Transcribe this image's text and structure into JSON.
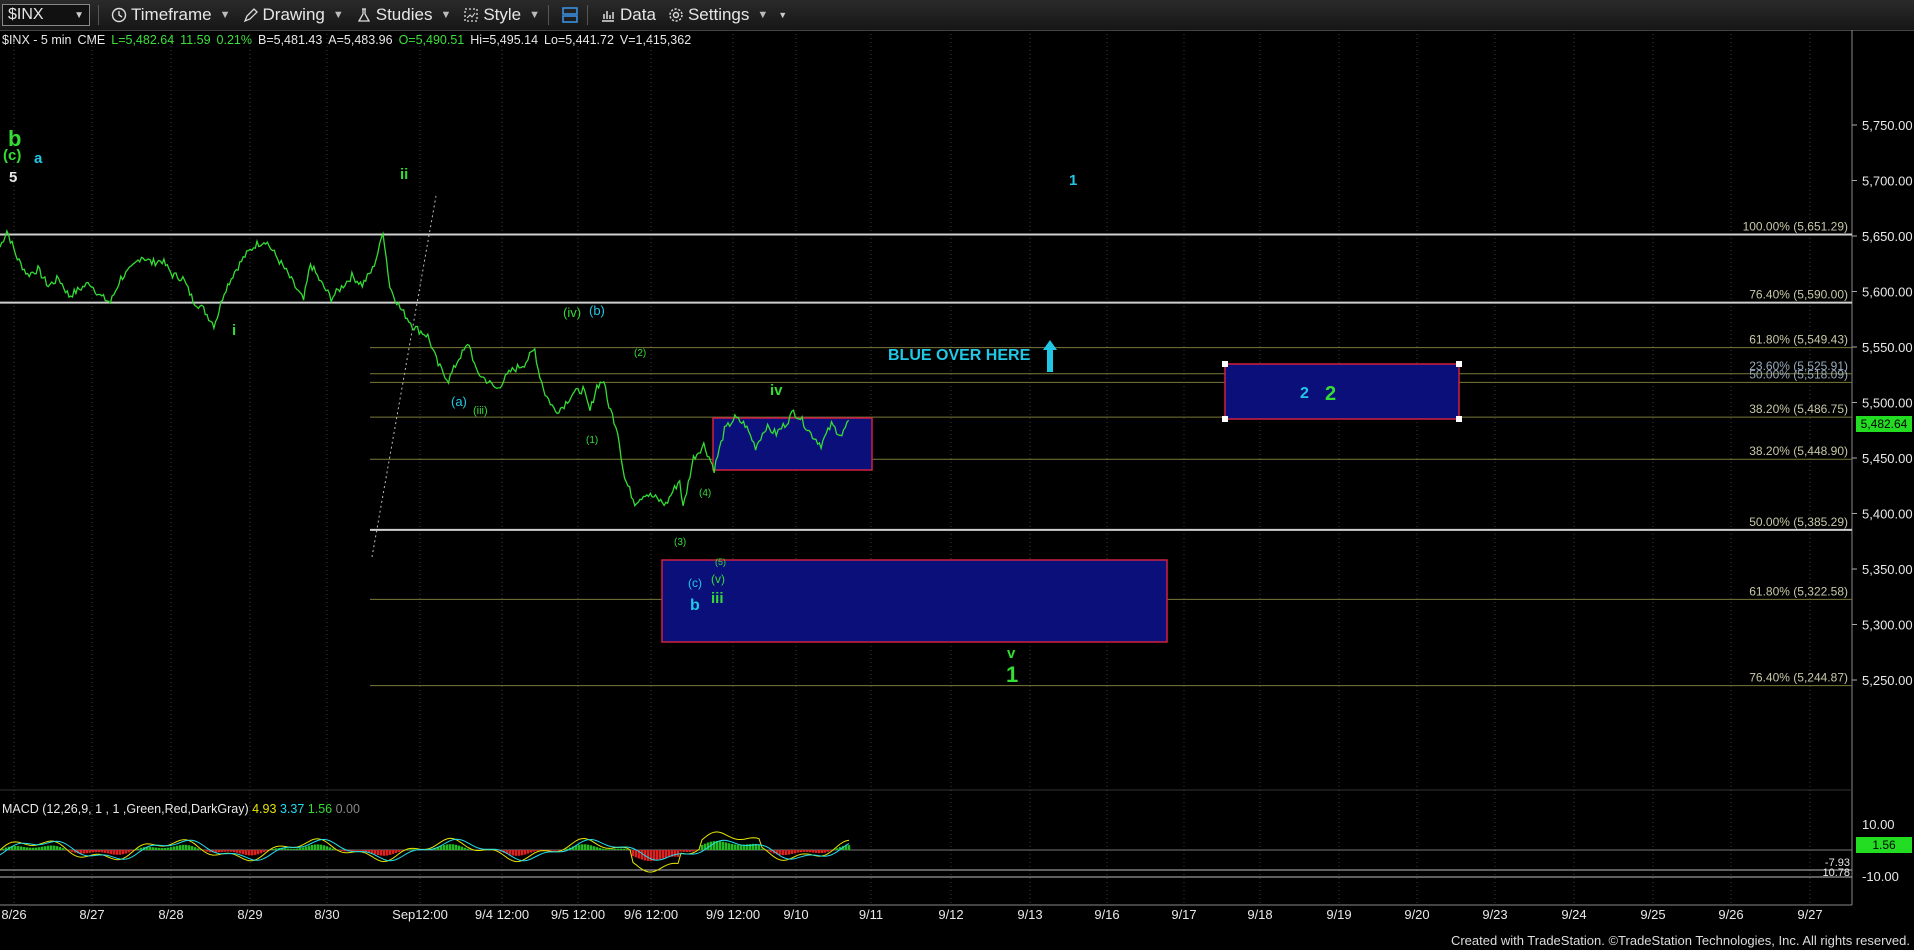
{
  "toolbar": {
    "symbol": "$INX",
    "timeframe": "Timeframe",
    "drawing": "Drawing",
    "studies": "Studies",
    "style": "Style",
    "data": "Data",
    "settings": "Settings"
  },
  "infobar": {
    "symbol": "$INX - 5 min",
    "exchange": "CME",
    "last": "L=5,482.64",
    "change": "11.59",
    "change_pct": "0.21%",
    "bid": "B=5,481.43",
    "ask": "A=5,483.96",
    "open": "O=5,490.51",
    "high": "Hi=5,495.14",
    "low": "Lo=5,441.72",
    "volume": "V=1,415,362"
  },
  "colors": {
    "background": "#000000",
    "price_line": "#33dd33",
    "fib_line": "#7a7a2a",
    "white_line": "#cfcfcf",
    "box_fill": "#0b0f7a",
    "box_border": "#d02040",
    "label_green": "#33dd33",
    "label_blue": "#3ab6e8",
    "label_cyan": "#21c8e6",
    "price_tag": "#22dd22"
  },
  "chart_data": {
    "type": "line",
    "price_axis": {
      "ticks": [
        "5,750.00",
        "5,700.00",
        "5,650.00",
        "5,600.00",
        "5,550.00",
        "5,500.00",
        "5,450.00",
        "5,400.00",
        "5,350.00",
        "5,300.00",
        "5,250.00"
      ],
      "ylim": [
        5215,
        5765
      ],
      "current_price": "5,482.64"
    },
    "macd_axis": {
      "ticks": [
        "10.00",
        "-10.00"
      ],
      "current": "1.56",
      "level_a": "-7.93",
      "level_b": "10.78"
    },
    "x_ticks": [
      "8/26",
      "8/27",
      "8/28",
      "8/29",
      "8/30",
      "Sep12:00",
      "9/4 12:00",
      "9/5 12:00",
      "9/6 12:00",
      "9/9 12:00",
      "9/10",
      "9/11",
      "9/12",
      "9/13",
      "9/16",
      "9/17",
      "9/18",
      "9/19",
      "9/20",
      "9/23",
      "9/24",
      "9/25",
      "9/26",
      "9/27"
    ],
    "fib_levels": [
      {
        "label": "100.00% (5,651.29)",
        "value": 5651.3
      },
      {
        "label": "76.40% (5,590.00)",
        "value": 5590.0
      },
      {
        "label": "61.80% (5,549.43)",
        "value": 5549.4
      },
      {
        "label": "23.60% (5,525.91)",
        "value": 5525.9
      },
      {
        "label": "50.00% (5,518.09)",
        "value": 5518.1
      },
      {
        "label": "38.20% (5,486.75)",
        "value": 5486.8
      },
      {
        "label": "38.20% (5,448.90)",
        "value": 5448.9
      },
      {
        "label": "50.00% (5,385.29)",
        "value": 5385.3
      },
      {
        "label": "61.80% (5,322.58)",
        "value": 5322.6
      },
      {
        "label": "76.40% (5,244.87)",
        "value": 5244.9
      }
    ],
    "price_series": [
      [
        0,
        5640
      ],
      [
        2,
        5655
      ],
      [
        5,
        5630
      ],
      [
        8,
        5615
      ],
      [
        11,
        5620
      ],
      [
        14,
        5605
      ],
      [
        17,
        5612
      ],
      [
        20,
        5596
      ],
      [
        23,
        5602
      ],
      [
        26,
        5608
      ],
      [
        29,
        5596
      ],
      [
        32,
        5590
      ],
      [
        35,
        5612
      ],
      [
        38,
        5620
      ],
      [
        41,
        5632
      ],
      [
        44,
        5626
      ],
      [
        47,
        5628
      ],
      [
        50,
        5615
      ],
      [
        53,
        5612
      ],
      [
        56,
        5592
      ],
      [
        59,
        5584
      ],
      [
        62,
        5570
      ],
      [
        63,
        5578
      ],
      [
        65,
        5600
      ],
      [
        68,
        5618
      ],
      [
        71,
        5632
      ],
      [
        74,
        5642
      ],
      [
        77,
        5646
      ],
      [
        80,
        5632
      ],
      [
        83,
        5618
      ],
      [
        86,
        5602
      ],
      [
        88,
        5592
      ],
      [
        90,
        5625
      ],
      [
        93,
        5608
      ],
      [
        96,
        5594
      ],
      [
        99,
        5604
      ],
      [
        102,
        5614
      ],
      [
        105,
        5606
      ],
      [
        108,
        5620
      ],
      [
        110,
        5640
      ],
      [
        111,
        5655
      ],
      [
        113,
        5604
      ],
      [
        116,
        5585
      ],
      [
        120,
        5568
      ],
      [
        124,
        5560
      ],
      [
        127,
        5534
      ],
      [
        130,
        5520
      ],
      [
        133,
        5540
      ],
      [
        136,
        5553
      ],
      [
        138,
        5528
      ],
      [
        141,
        5520
      ],
      [
        144,
        5512
      ],
      [
        148,
        5528
      ],
      [
        152,
        5535
      ],
      [
        155,
        5548
      ],
      [
        156,
        5530
      ],
      [
        158,
        5508
      ],
      [
        161,
        5492
      ],
      [
        163,
        5496
      ],
      [
        166,
        5508
      ],
      [
        169,
        5512
      ],
      [
        171,
        5492
      ],
      [
        173,
        5515
      ],
      [
        175,
        5520
      ],
      [
        176,
        5502
      ],
      [
        179,
        5475
      ],
      [
        181,
        5432
      ],
      [
        184,
        5410
      ],
      [
        187,
        5418
      ],
      [
        190,
        5414
      ],
      [
        193,
        5408
      ],
      [
        195,
        5420
      ],
      [
        197,
        5430
      ],
      [
        198,
        5405
      ],
      [
        201,
        5450
      ],
      [
        204,
        5462
      ],
      [
        207,
        5440
      ],
      [
        210,
        5475
      ],
      [
        213,
        5486
      ],
      [
        216,
        5480
      ],
      [
        219,
        5460
      ],
      [
        222,
        5478
      ],
      [
        225,
        5472
      ],
      [
        228,
        5482
      ],
      [
        230,
        5492
      ],
      [
        232,
        5486
      ],
      [
        235,
        5472
      ],
      [
        238,
        5462
      ],
      [
        241,
        5480
      ],
      [
        244,
        5470
      ],
      [
        246,
        5484
      ]
    ],
    "x_index_ticks": [
      "8/26",
      "8/27",
      "8/28",
      "8/29",
      "8/30",
      "Sep12:00",
      "9/4 12:00",
      "9/5 12:00",
      "9/6 12:00",
      "9/9 12:00",
      "9/10"
    ],
    "macd": {
      "label": "MACD (12,26,9, 1 , 1 ,Green,Red,DarkGray)",
      "v1": "4.93",
      "v2": "3.37",
      "v3": "1.56",
      "v4": "0.00"
    },
    "annotations": {
      "b": "b",
      "c_a": "(c)",
      "a": "a",
      "five": "5",
      "ii": "ii",
      "i": "i",
      "iv_b1": "(iv)",
      "iv_b2": "(b)",
      "a_paren": "(a)",
      "iii_paren": "(iii)",
      "two_paren": "(2)",
      "one_paren": "(1)",
      "four_paren": "(4)",
      "three_paren": "(3)",
      "five_paren": "(5)",
      "v_paren": "(v)",
      "c_paren": "(c)",
      "b_blue": "b",
      "iii": "iii",
      "iv": "iv",
      "v": "v",
      "one_green": "1",
      "one_blue": "1",
      "blue_over_here": "BLUE OVER HERE",
      "two_blue": "2",
      "two_green": "2"
    }
  },
  "footer": "Created with TradeStation. ©TradeStation Technologies, Inc. All rights reserved."
}
